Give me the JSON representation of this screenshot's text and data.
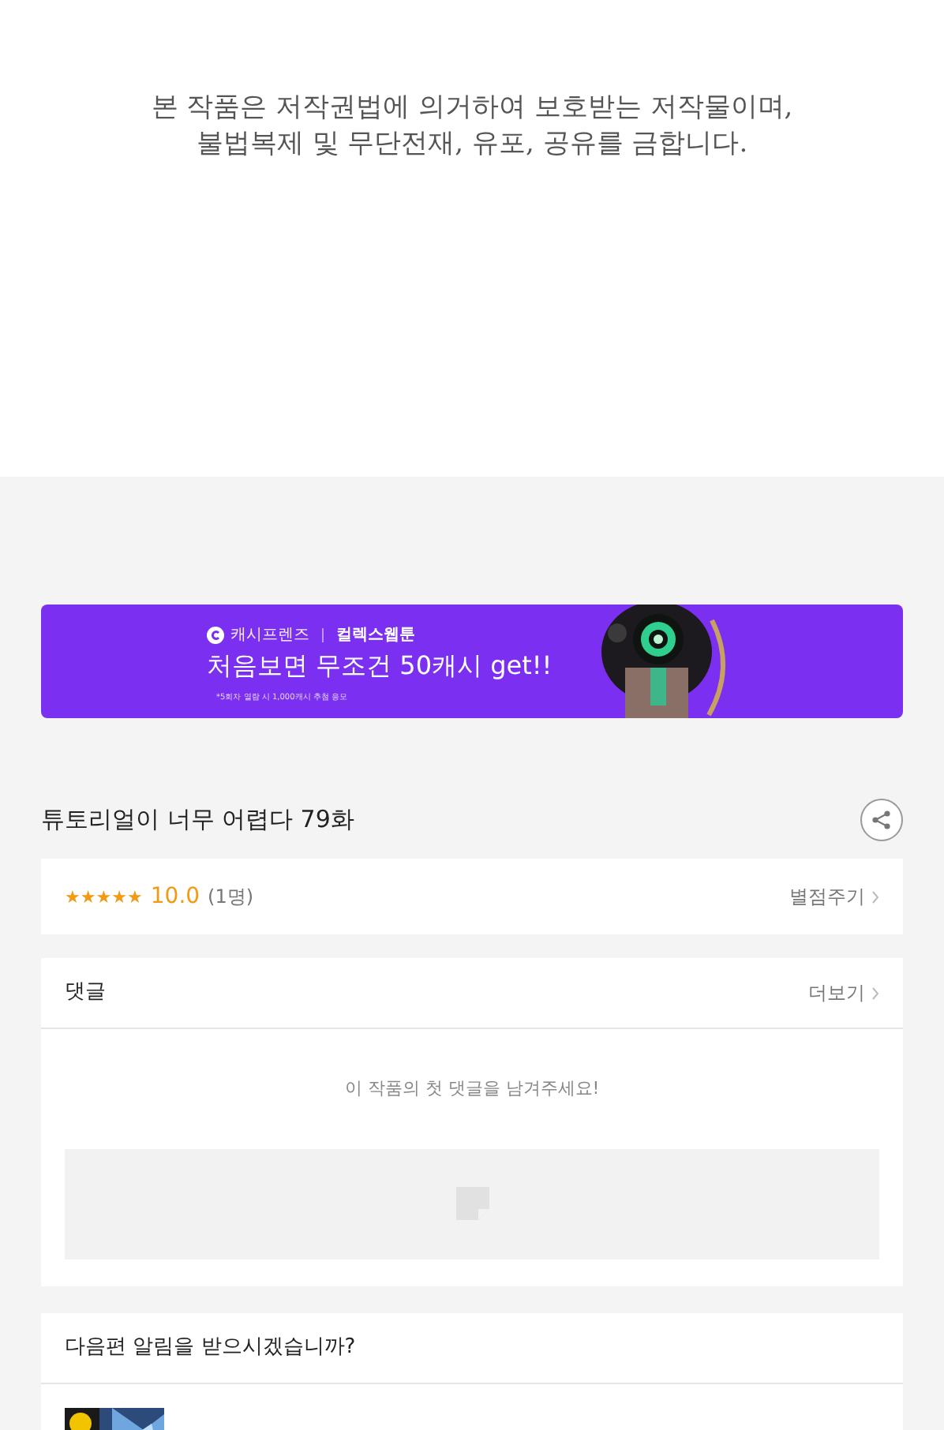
{
  "copyright_notice": {
    "lines": [
      "본 작품은 저작권법에 의거하여 보호받는 저작물이며,",
      "불법복제 및 무단전재, 유포, 공유를 금합니다."
    ]
  },
  "banner": {
    "brand": "캐시프렌즈",
    "partner": "컬렉스웹툰",
    "headline": "처음보면 무조건 50캐시 get!!",
    "note": "*5회차 열람 시 1,000캐시 추첨 응모"
  },
  "episode": {
    "title": "튜토리얼이 너무 어렵다 79화"
  },
  "rating": {
    "stars": 5,
    "score": "10.0",
    "count": "(1명)",
    "action": "별점주기"
  },
  "comments": {
    "title": "댓글",
    "more": "더보기",
    "empty_message": "이 작품의 첫 댓글을 남겨주세요!"
  },
  "notification": {
    "question": "다음편 알림을 받으시겠습니까?"
  }
}
